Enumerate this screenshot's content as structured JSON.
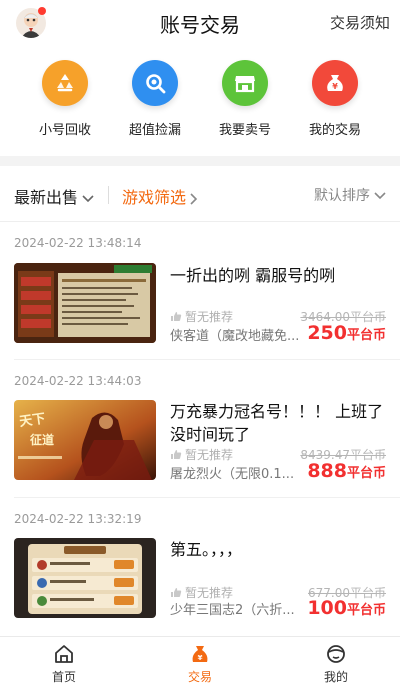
{
  "header": {
    "title": "账号交易",
    "notice_link": "交易须知"
  },
  "quick_actions": [
    {
      "label": "小号回收",
      "icon": "recycle-icon",
      "color": "#f6a12a"
    },
    {
      "label": "超值捡漏",
      "icon": "magnifier-icon",
      "color": "#2f8ff0"
    },
    {
      "label": "我要卖号",
      "icon": "store-icon",
      "color": "#5dc43a"
    },
    {
      "label": "我的交易",
      "icon": "moneybag-icon",
      "color": "#f2493a"
    }
  ],
  "filters": {
    "latest": "最新出售",
    "game_filter": "游戏筛选",
    "sort": "默认排序"
  },
  "listings": [
    {
      "date": "2024-02-22 13:48:14",
      "title": "一折出的咧 霸服号的咧",
      "recommend": "暂无推荐",
      "subtitle": "侠客道（魔改地藏免...",
      "original_price": "3464.00平台币",
      "price": "250",
      "price_unit": "平台币"
    },
    {
      "date": "2024-02-22 13:44:03",
      "title": "万充暴力冠名号！！！ 上班了没时间玩了",
      "recommend": "暂无推荐",
      "subtitle": "屠龙烈火（无限0.1...",
      "original_price": "8439.47平台币",
      "price": "888",
      "price_unit": "平台币"
    },
    {
      "date": "2024-02-22 13:32:19",
      "title": "第五。，，，",
      "recommend": "暂无推荐",
      "subtitle": "少年三国志2（六折...",
      "original_price": "677.00平台币",
      "price": "100",
      "price_unit": "平台币"
    }
  ],
  "bottom_nav": [
    {
      "label": "首页",
      "icon": "home-icon",
      "active": false
    },
    {
      "label": "交易",
      "icon": "trade-icon",
      "active": true
    },
    {
      "label": "我的",
      "icon": "profile-icon",
      "active": false
    }
  ],
  "colors": {
    "accent": "#f36a12",
    "price": "#f23030"
  }
}
